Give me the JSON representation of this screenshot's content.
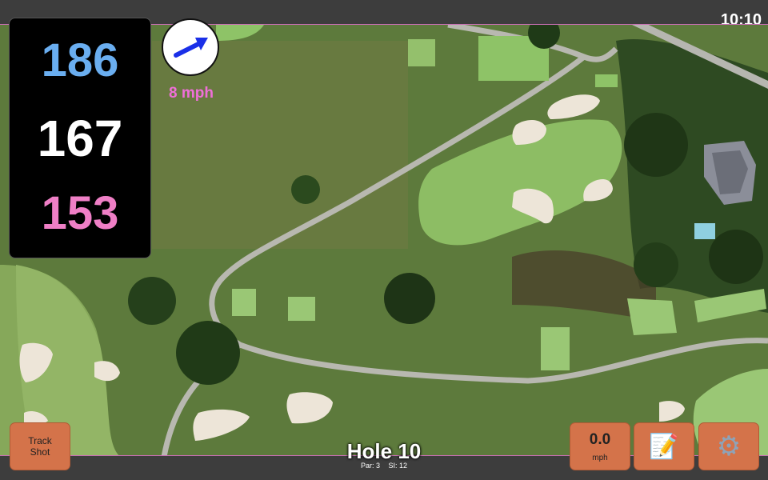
{
  "status_bar": {
    "time": "10:10"
  },
  "distances": {
    "back": "186",
    "middle": "167",
    "front": "153",
    "colors": {
      "back": "#6aaef0",
      "middle": "#ffffff",
      "front": "#ef7fc6"
    }
  },
  "wind": {
    "speed_label": "8 mph",
    "arrow_color": "#1a2fe8",
    "label_color": "#ef6fd8"
  },
  "hole": {
    "title": "Hole 10",
    "par_label": "Par: 3",
    "si_label": "SI: 12"
  },
  "buttons": {
    "track_shot_line1": "Track",
    "track_shot_line2": "Shot",
    "speed_value": "0.0",
    "speed_unit": "mph",
    "notes_icon": "notepad-icon",
    "settings_icon": "gear-icon"
  },
  "colors": {
    "accent_button": "#d4734a",
    "map_border": "#c86fb4"
  }
}
